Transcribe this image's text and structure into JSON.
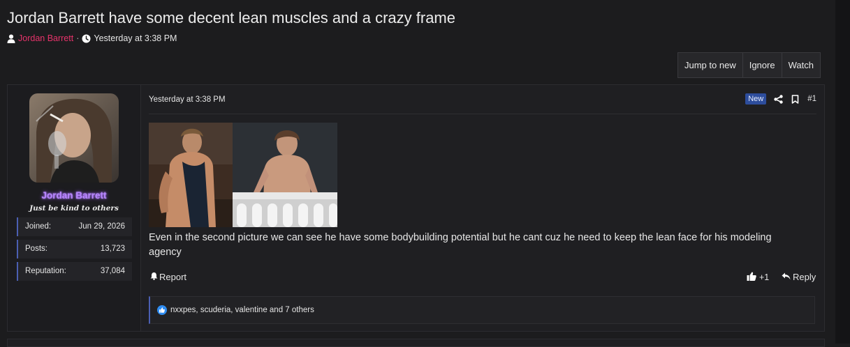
{
  "thread": {
    "title": "Jordan Barrett have some decent lean muscles and a crazy frame",
    "author": "Jordan Barrett",
    "separator": "·",
    "time": "Yesterday at 3:38 PM"
  },
  "actions": [
    "Jump to new",
    "Ignore",
    "Watch"
  ],
  "post": {
    "user": {
      "name": "Jordan Barrett",
      "title": "Just be kind to others",
      "name_color": "#b886ff",
      "stats": [
        {
          "label": "Joined:",
          "value": "Jun 29, 2026"
        },
        {
          "label": "Posts:",
          "value": "13,723"
        },
        {
          "label": "Reputation:",
          "value": "37,084"
        }
      ]
    },
    "date": "Yesterday at 3:38 PM",
    "badge": "New",
    "number": "#1",
    "body": "Even in the second picture we can see he have some bodybuilding potential but he cant cuz he need to keep the lean face for his modeling agency",
    "report_label": "Report",
    "reaction_count": "+1",
    "reply_label": "Reply",
    "reactions_text": "nxxpes, scuderia, valentine and 7 others"
  },
  "colors": {
    "background": "#1c1c1e",
    "author_link": "#e8336b",
    "accent_border": "#4b5fb3",
    "new_badge": "#2d4d9c",
    "like_icon": "#2f8cf0"
  }
}
